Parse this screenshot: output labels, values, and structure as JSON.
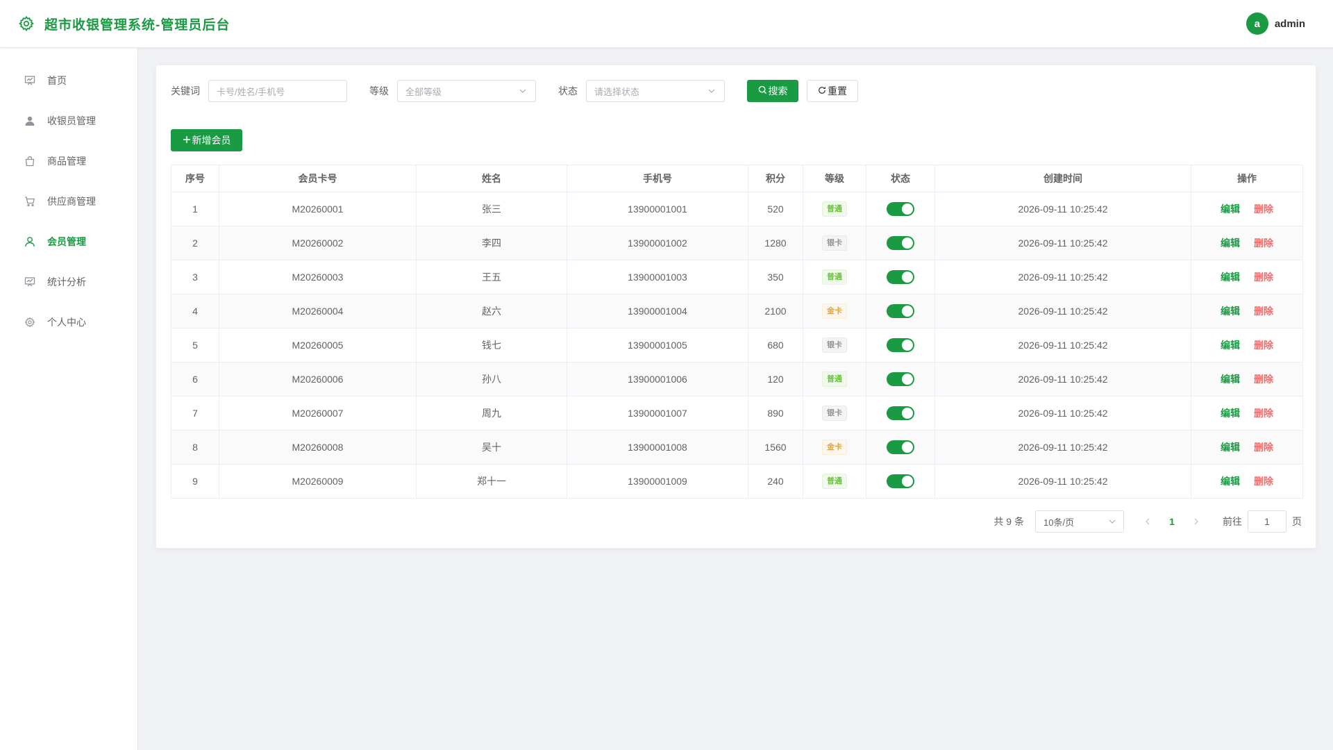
{
  "header": {
    "title": "超市收银管理系统-管理员后台",
    "avatar_letter": "a",
    "username": "admin"
  },
  "sidebar": {
    "items": [
      {
        "label": "首页",
        "icon": "presentation-icon",
        "active": false
      },
      {
        "label": "收银员管理",
        "icon": "user-solid-icon",
        "active": false
      },
      {
        "label": "商品管理",
        "icon": "shopping-bag-icon",
        "active": false
      },
      {
        "label": "供应商管理",
        "icon": "shopping-cart-icon",
        "active": false
      },
      {
        "label": "会员管理",
        "icon": "user-icon",
        "active": true
      },
      {
        "label": "统计分析",
        "icon": "presentation-icon",
        "active": false
      },
      {
        "label": "个人中心",
        "icon": "gear-icon",
        "active": false
      }
    ]
  },
  "filters": {
    "keyword_label": "关键词",
    "keyword_placeholder": "卡号/姓名/手机号",
    "level_label": "等级",
    "level_value": "全部等级",
    "status_label": "状态",
    "status_placeholder": "请选择状态",
    "search_label": "搜索",
    "reset_label": "重置"
  },
  "add_button_label": "新增会员",
  "table": {
    "headers": [
      "序号",
      "会员卡号",
      "姓名",
      "手机号",
      "积分",
      "等级",
      "状态",
      "创建时间",
      "操作"
    ],
    "edit_label": "编辑",
    "delete_label": "删除",
    "rows": [
      {
        "no": "1",
        "card": "M20260001",
        "name": "张三",
        "phone": "13900001001",
        "points": "520",
        "level": "普通",
        "level_color": "green",
        "enabled": true,
        "created": "2026-09-11 10:25:42"
      },
      {
        "no": "2",
        "card": "M20260002",
        "name": "李四",
        "phone": "13900001002",
        "points": "1280",
        "level": "银卡",
        "level_color": "gray",
        "enabled": true,
        "created": "2026-09-11 10:25:42"
      },
      {
        "no": "3",
        "card": "M20260003",
        "name": "王五",
        "phone": "13900001003",
        "points": "350",
        "level": "普通",
        "level_color": "green",
        "enabled": true,
        "created": "2026-09-11 10:25:42"
      },
      {
        "no": "4",
        "card": "M20260004",
        "name": "赵六",
        "phone": "13900001004",
        "points": "2100",
        "level": "金卡",
        "level_color": "gold",
        "enabled": true,
        "created": "2026-09-11 10:25:42"
      },
      {
        "no": "5",
        "card": "M20260005",
        "name": "钱七",
        "phone": "13900001005",
        "points": "680",
        "level": "银卡",
        "level_color": "gray",
        "enabled": true,
        "created": "2026-09-11 10:25:42"
      },
      {
        "no": "6",
        "card": "M20260006",
        "name": "孙八",
        "phone": "13900001006",
        "points": "120",
        "level": "普通",
        "level_color": "green",
        "enabled": true,
        "created": "2026-09-11 10:25:42"
      },
      {
        "no": "7",
        "card": "M20260007",
        "name": "周九",
        "phone": "13900001007",
        "points": "890",
        "level": "银卡",
        "level_color": "gray",
        "enabled": true,
        "created": "2026-09-11 10:25:42"
      },
      {
        "no": "8",
        "card": "M20260008",
        "name": "吴十",
        "phone": "13900001008",
        "points": "1560",
        "level": "金卡",
        "level_color": "gold",
        "enabled": true,
        "created": "2026-09-11 10:25:42"
      },
      {
        "no": "9",
        "card": "M20260009",
        "name": "郑十一",
        "phone": "13900001009",
        "points": "240",
        "level": "普通",
        "level_color": "green",
        "enabled": true,
        "created": "2026-09-11 10:25:42"
      }
    ]
  },
  "pagination": {
    "total_text": "共 9 条",
    "page_size": "10条/页",
    "current_page": "1",
    "goto_label": "前往",
    "goto_value": "1",
    "page_suffix": "页"
  },
  "colors": {
    "primary": "#1a9b43",
    "danger": "#f56c6c",
    "tag_green": "#67c23a",
    "tag_gray": "#909399",
    "tag_gold": "#e6a23c"
  }
}
